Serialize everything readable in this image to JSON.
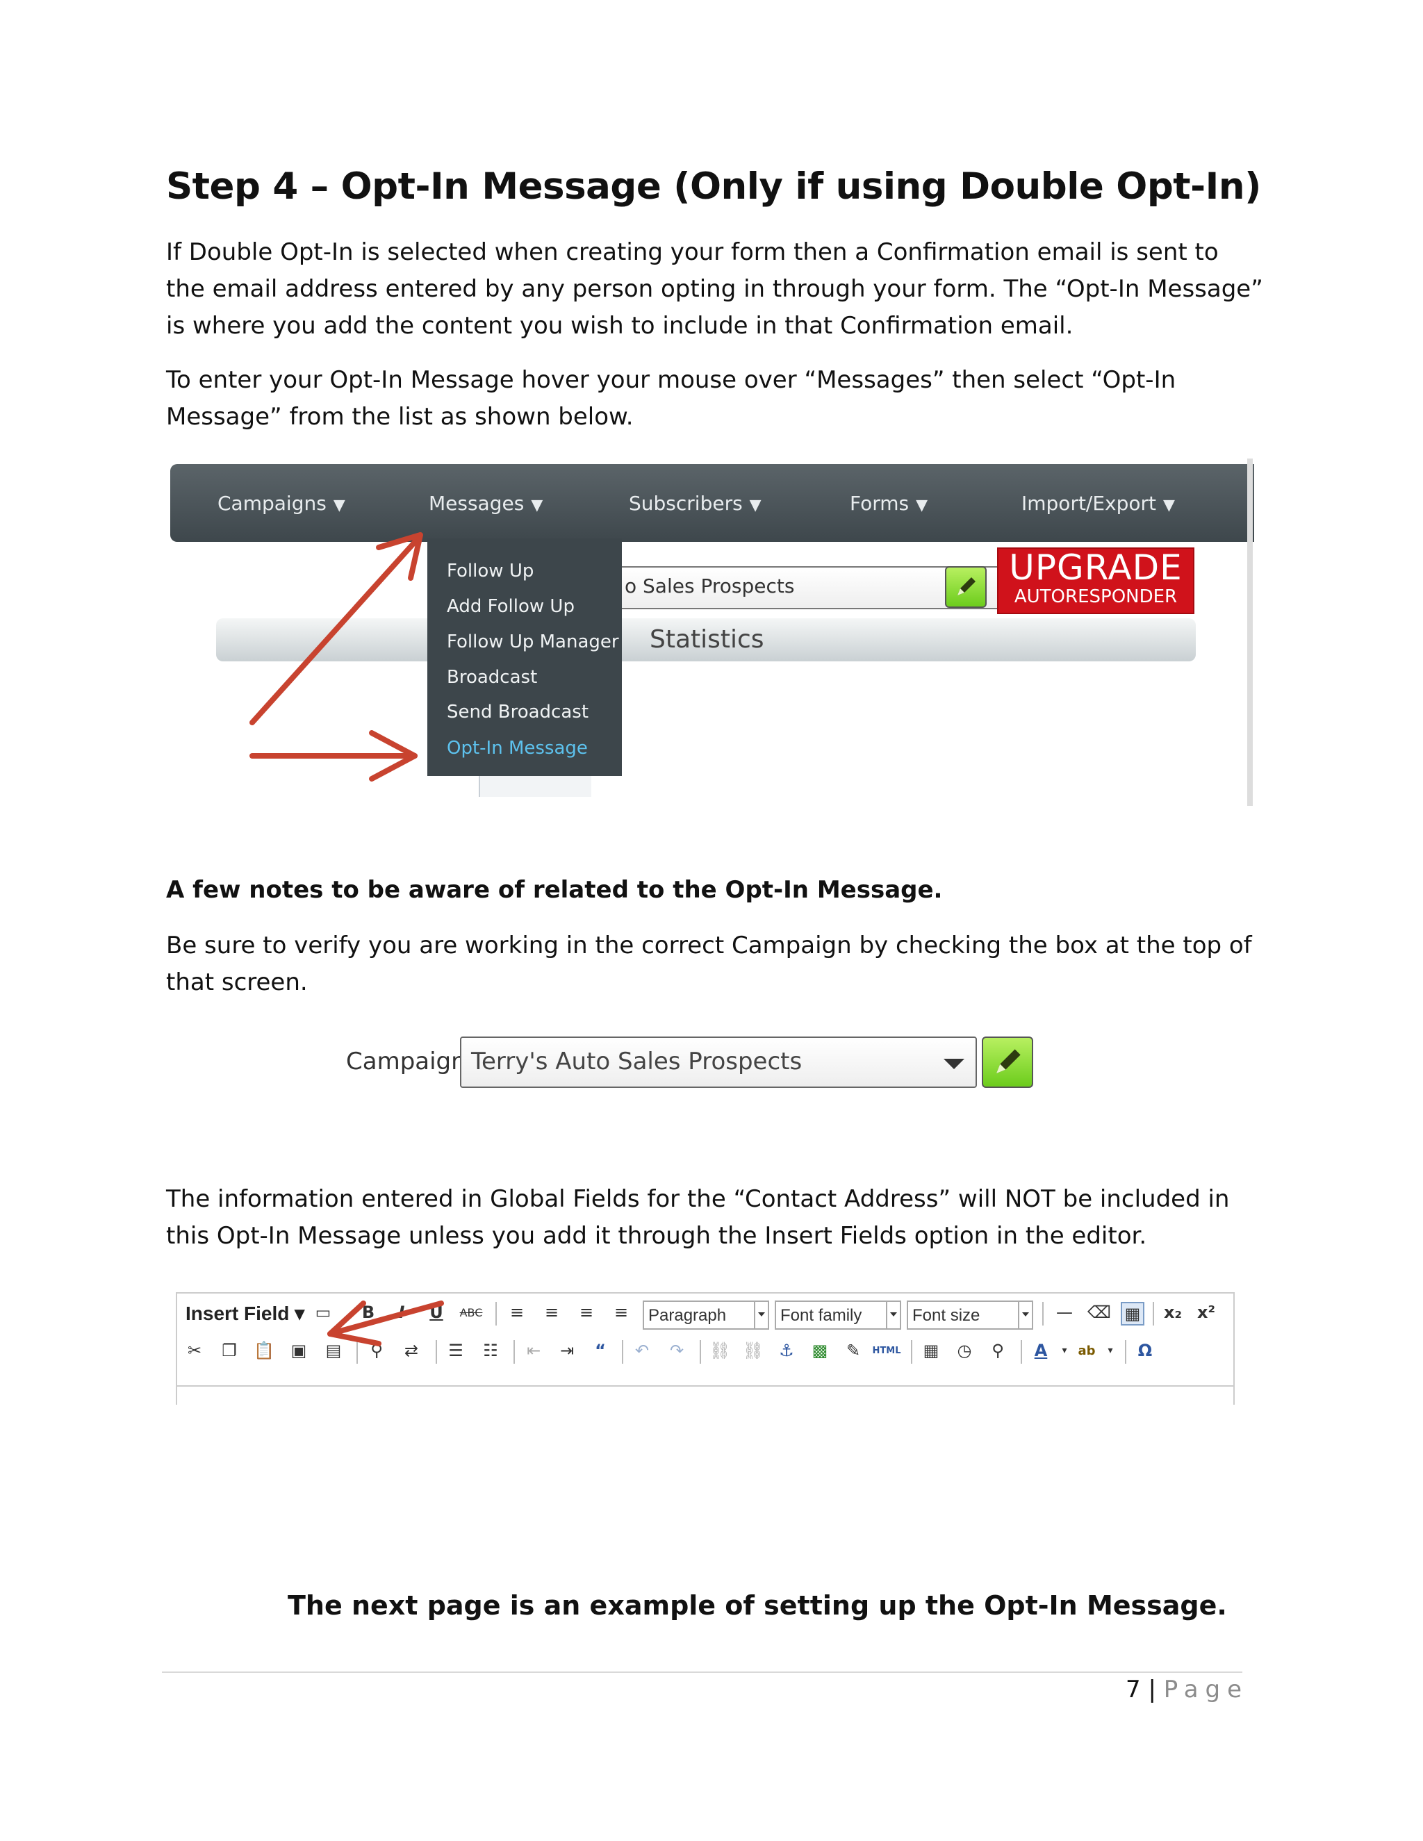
{
  "heading": "Step 4 – Opt-In Message (Only if using Double Opt-In)",
  "intro_paragraph": "If Double Opt-In is selected when creating your form then a Confirmation email is sent to the email address entered by any person opting in through your form. The “Opt-In Message” is where you add the content you wish to include in that Confirmation email.",
  "instruction_paragraph": "To enter your Opt-In Message hover your mouse over “Messages” then select “Opt-In Message” from the list as shown below.",
  "screenshot1": {
    "nav": [
      "Campaigns",
      "Messages",
      "Subscribers",
      "Forms",
      "Import/Export"
    ],
    "caret": "▼",
    "dropdown": [
      "Follow Up",
      "Add Follow Up",
      "Follow Up Manager",
      "Broadcast",
      "Send Broadcast",
      "Opt-In Message"
    ],
    "campaign_partial": "o Sales Prospects",
    "upgrade_big": "UPGRADE",
    "upgrade_small": "AUTORESPONDER",
    "statistics": "Statistics",
    "arrow_color": "#c8432f",
    "active_color": "#5dc2ee"
  },
  "notes_heading": "A few notes to be aware of related to the Opt-In Message.",
  "notes_paragraph": "Be sure to verify you are working in the correct Campaign by checking the box at the top of that screen.",
  "screenshot2": {
    "label": "Campaign",
    "value": "Terry's Auto Sales Prospects"
  },
  "global_fields_paragraph": "The information entered in Global Fields for the “Contact Address” will NOT be included in this Opt-In Message unless you add it through the Insert Fields option in the editor.",
  "screenshot3": {
    "insert_field": "Insert Field ▾",
    "paragraph": "Paragraph",
    "font_family": "Font family",
    "font_size": "Font size"
  },
  "next_page_note": "The next page is an example of setting up the Opt-In Message.",
  "footer": {
    "page_number": "7",
    "separator": "|",
    "page_label": "Page"
  }
}
